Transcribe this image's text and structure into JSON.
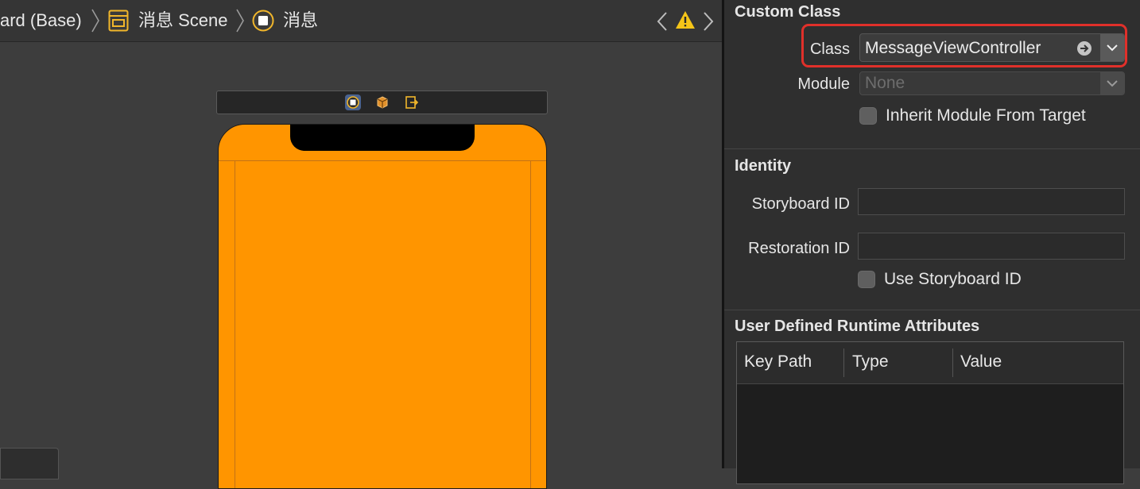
{
  "breadcrumb": {
    "storyboard": "ard (Base)",
    "scene": "消息 Scene",
    "controller": "消息"
  },
  "icons": {
    "storyboard_scene": "storyboard-scene-icon",
    "view_controller": "view-controller-icon",
    "first_responder": "first-responder-cube-icon",
    "exit": "exit-icon",
    "warning": "warning-icon",
    "nav_back": "chevron-left-icon",
    "nav_forward": "chevron-right-icon",
    "goto": "arrow-circle-right-icon"
  },
  "colors": {
    "view_background": "#ff9500",
    "highlight": "#e0302a",
    "warning": "#f5c518"
  },
  "inspector": {
    "custom_class": {
      "title": "Custom Class",
      "class_label": "Class",
      "class_value": "MessageViewController",
      "module_label": "Module",
      "module_placeholder": "None",
      "inherit_label": "Inherit Module From Target"
    },
    "identity": {
      "title": "Identity",
      "storyboard_id_label": "Storyboard ID",
      "storyboard_id_value": "",
      "restoration_id_label": "Restoration ID",
      "restoration_id_value": "",
      "use_storyboard_id_label": "Use Storyboard ID"
    },
    "runtime_attributes": {
      "title": "User Defined Runtime Attributes",
      "columns": [
        "Key Path",
        "Type",
        "Value"
      ]
    }
  }
}
